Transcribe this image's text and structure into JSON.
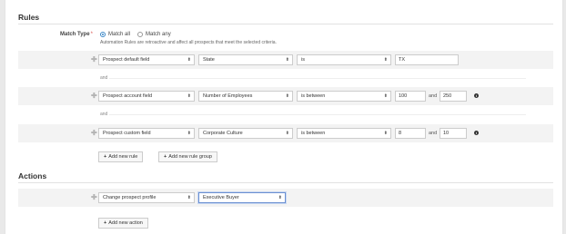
{
  "rules": {
    "title": "Rules",
    "match_type_label": "Match Type",
    "required_mark": "*",
    "options": [
      {
        "label": "Match all",
        "checked": true
      },
      {
        "label": "Match any",
        "checked": false
      }
    ],
    "hint": "Automation Rules are retroactive and affect all prospects that meet the selected criteria.",
    "and_label": "and",
    "rows": [
      {
        "field_type": "Prospect default field",
        "field": "State",
        "operator": "is",
        "value": "TX"
      },
      {
        "field_type": "Prospect account field",
        "field": "Number of Employees",
        "operator": "is between",
        "value": "100",
        "value_and": "and",
        "value2": "250"
      },
      {
        "field_type": "Prospect custom field",
        "field": "Corporate Culture",
        "operator": "is between",
        "value": "8",
        "value_and": "and",
        "value2": "10"
      }
    ],
    "add_rule_label": "Add new rule",
    "add_group_label": "Add new rule group"
  },
  "actions": {
    "title": "Actions",
    "rows": [
      {
        "action": "Change prospect profile",
        "value": "Executive Buyer"
      }
    ],
    "add_action_label": "Add new action"
  }
}
